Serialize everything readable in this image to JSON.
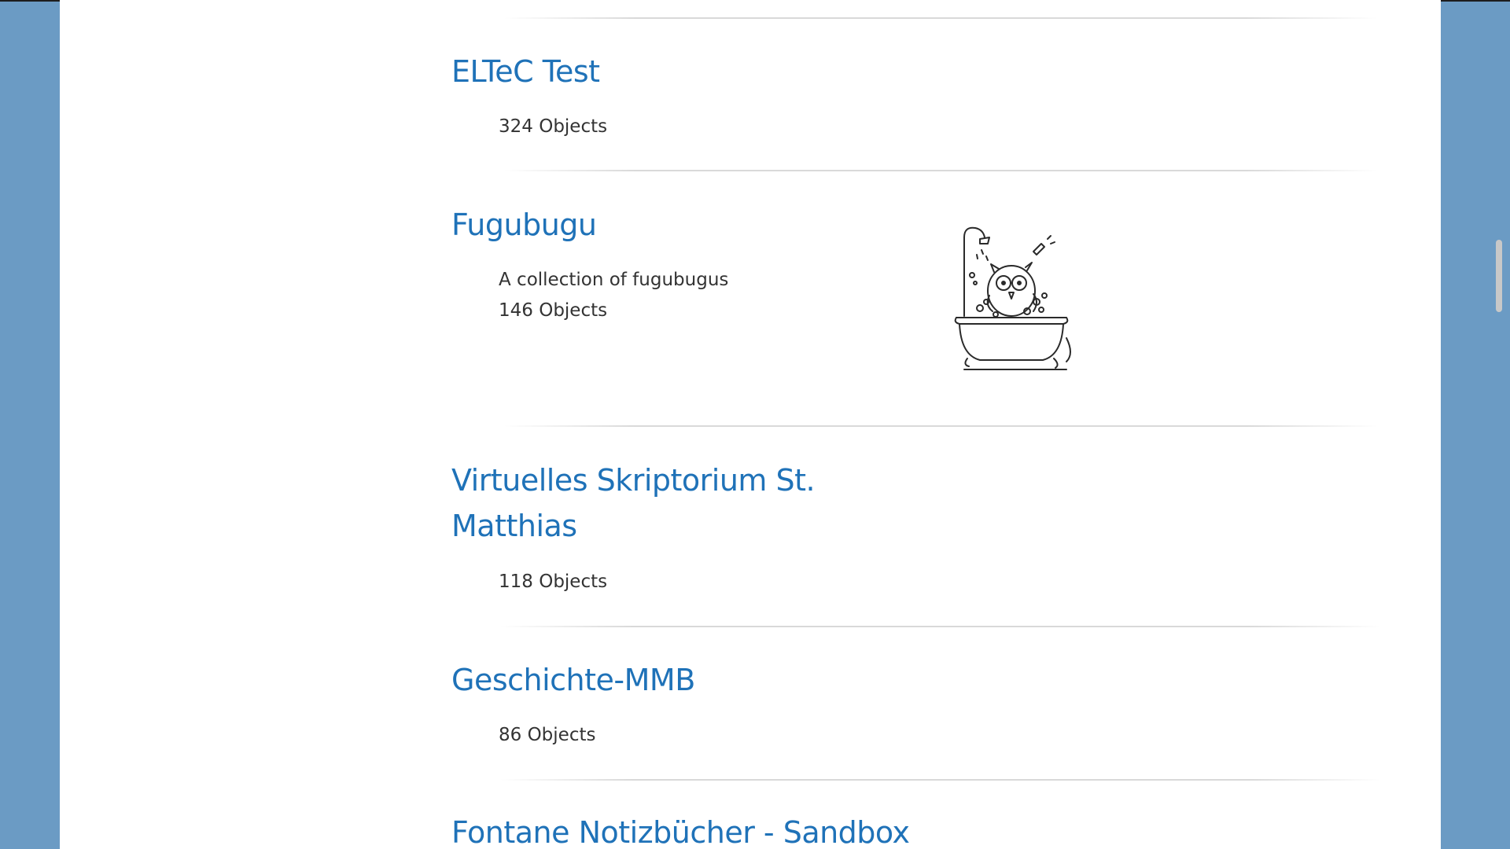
{
  "collections": [
    {
      "title": "ELTeC Test",
      "count": "324 Objects"
    },
    {
      "title": "Fugubugu",
      "description": "A collection of fugubugus",
      "count": "146 Objects",
      "thumbnail_icon": "owl-in-bathtub-sketch"
    },
    {
      "title_line1": "Virtuelles Skriptorium St.",
      "title_line2": "Matthias",
      "count": "118 Objects"
    },
    {
      "title": "Geschichte-MMB",
      "count": "86 Objects"
    },
    {
      "title": "Fontane Notizbücher - Sandbox"
    }
  ],
  "colors": {
    "background": "#6b9bc4",
    "page": "#ffffff",
    "title": "#1f72b8",
    "text": "#333333",
    "divider": "#d9d9d9"
  }
}
